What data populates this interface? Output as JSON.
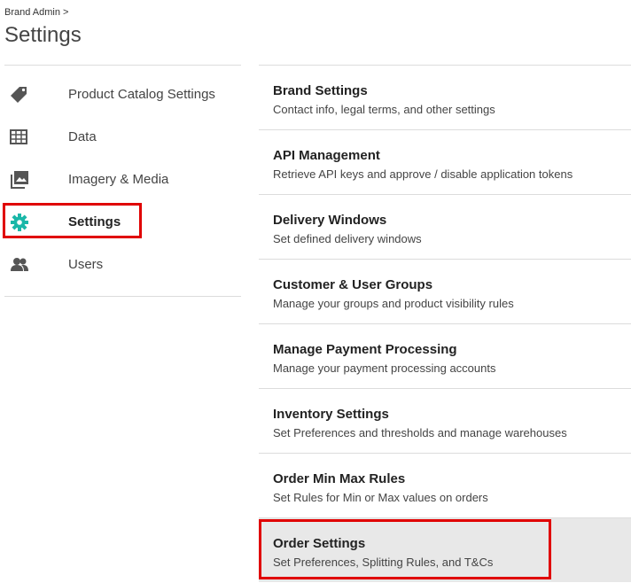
{
  "breadcrumb": "Brand Admin >",
  "page_title": "Settings",
  "sidebar": {
    "items": [
      {
        "label": "Product Catalog Settings",
        "icon": "tag-icon"
      },
      {
        "label": "Data",
        "icon": "table-icon"
      },
      {
        "label": "Imagery & Media",
        "icon": "image-icon"
      },
      {
        "label": "Settings",
        "icon": "gear-icon",
        "active": true
      },
      {
        "label": "Users",
        "icon": "users-icon"
      }
    ]
  },
  "settings": [
    {
      "title": "Brand Settings",
      "desc": "Contact info, legal terms, and other settings"
    },
    {
      "title": "API Management",
      "desc": "Retrieve API keys and approve / disable application tokens"
    },
    {
      "title": "Delivery Windows",
      "desc": "Set defined delivery windows"
    },
    {
      "title": "Customer & User Groups",
      "desc": "Manage your groups and product visibility rules"
    },
    {
      "title": "Manage Payment Processing",
      "desc": "Manage your payment processing accounts"
    },
    {
      "title": "Inventory Settings",
      "desc": "Set Preferences and thresholds and manage warehouses"
    },
    {
      "title": "Order Min Max Rules",
      "desc": "Set Rules for Min or Max values on orders"
    },
    {
      "title": "Order Settings",
      "desc": "Set Preferences, Splitting Rules, and T&Cs",
      "selected": true
    }
  ],
  "colors": {
    "accent": "#1ab7a8",
    "highlight": "#e00000",
    "icon": "#555555"
  }
}
